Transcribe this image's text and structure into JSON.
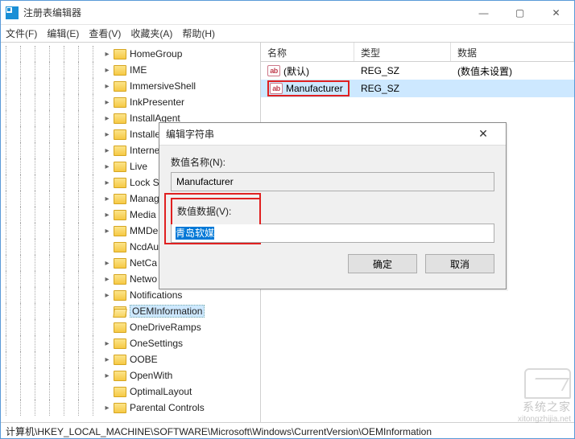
{
  "window": {
    "title": "注册表编辑器",
    "min": "—",
    "max": "▢",
    "close": "✕"
  },
  "menu": {
    "file": "文件(F)",
    "edit": "编辑(E)",
    "view": "查看(V)",
    "favorites": "收藏夹(A)",
    "help": "帮助(H)"
  },
  "tree": {
    "items": [
      {
        "label": "HomeGroup",
        "depth": 7,
        "exp": "▸"
      },
      {
        "label": "IME",
        "depth": 7,
        "exp": "▸"
      },
      {
        "label": "ImmersiveShell",
        "depth": 7,
        "exp": "▸"
      },
      {
        "label": "InkPresenter",
        "depth": 7,
        "exp": "▸"
      },
      {
        "label": "InstallAgent",
        "depth": 7,
        "exp": "▸"
      },
      {
        "label": "Installe",
        "depth": 7,
        "exp": "▸"
      },
      {
        "label": "Interne",
        "depth": 7,
        "exp": "▸"
      },
      {
        "label": "Live",
        "depth": 7,
        "exp": "▸"
      },
      {
        "label": "Lock S",
        "depth": 7,
        "exp": "▸"
      },
      {
        "label": "Manag",
        "depth": 7,
        "exp": "▸"
      },
      {
        "label": "Media",
        "depth": 7,
        "exp": "▸"
      },
      {
        "label": "MMDe",
        "depth": 7,
        "exp": "▸"
      },
      {
        "label": "NcdAu",
        "depth": 7,
        "exp": ""
      },
      {
        "label": "NetCa",
        "depth": 7,
        "exp": "▸"
      },
      {
        "label": "Netwo",
        "depth": 7,
        "exp": "▸"
      },
      {
        "label": "Notifications",
        "depth": 7,
        "exp": "▸"
      },
      {
        "label": "OEMInformation",
        "depth": 7,
        "exp": "",
        "selected": true
      },
      {
        "label": "OneDriveRamps",
        "depth": 7,
        "exp": ""
      },
      {
        "label": "OneSettings",
        "depth": 7,
        "exp": "▸"
      },
      {
        "label": "OOBE",
        "depth": 7,
        "exp": "▸"
      },
      {
        "label": "OpenWith",
        "depth": 7,
        "exp": "▸"
      },
      {
        "label": "OptimalLayout",
        "depth": 7,
        "exp": ""
      },
      {
        "label": "Parental Controls",
        "depth": 7,
        "exp": "▸"
      }
    ]
  },
  "list": {
    "headers": {
      "name": "名称",
      "type": "类型",
      "data": "数据"
    },
    "rows": [
      {
        "name": "(默认)",
        "type": "REG_SZ",
        "data": "(数值未设置)",
        "selected": false,
        "highlight": false
      },
      {
        "name": "Manufacturer",
        "type": "REG_SZ",
        "data": "",
        "selected": true,
        "highlight": true
      }
    ]
  },
  "dialog": {
    "title": "编辑字符串",
    "close": "✕",
    "name_label": "数值名称(N):",
    "name_value": "Manufacturer",
    "data_label": "数值数据(V):",
    "data_value": "青岛软媒",
    "ok": "确定",
    "cancel": "取消"
  },
  "statusbar": {
    "path": "计算机\\HKEY_LOCAL_MACHINE\\SOFTWARE\\Microsoft\\Windows\\CurrentVersion\\OEMInformation"
  },
  "watermark": {
    "name": "系统之家",
    "url": "xitongzhijia.net"
  }
}
